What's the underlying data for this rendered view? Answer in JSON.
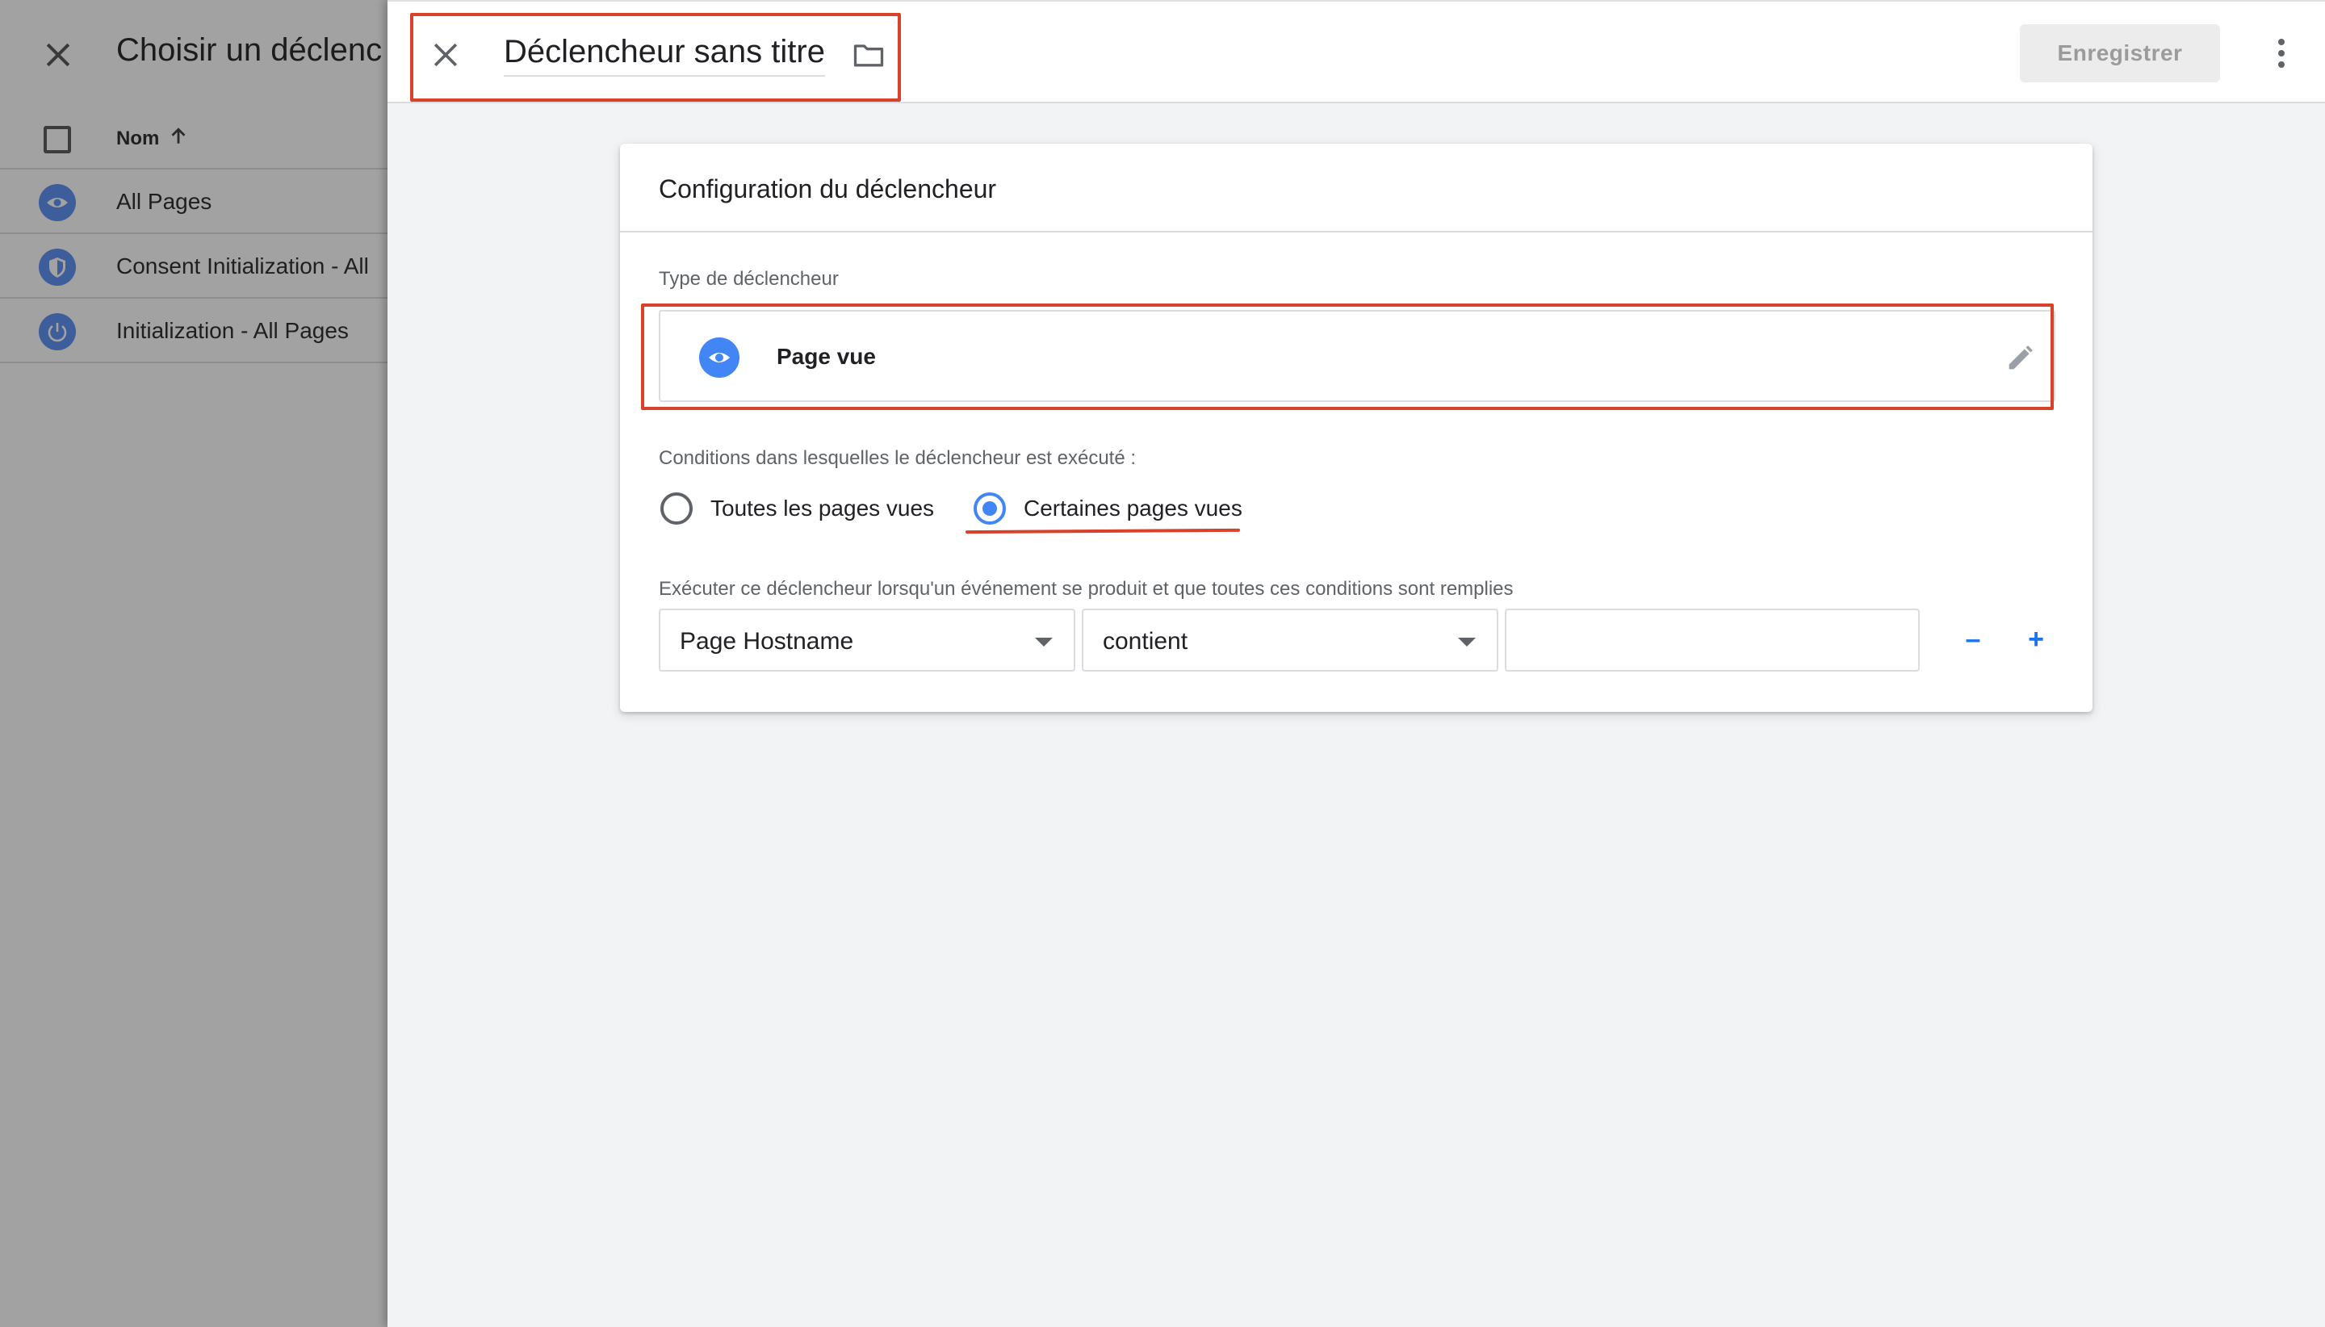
{
  "background_panel": {
    "title": "Choisir un déclenc",
    "column_header": "Nom",
    "rows": [
      {
        "label": "All Pages",
        "icon": "eye-icon"
      },
      {
        "label": "Consent Initialization - All",
        "icon": "shield-icon"
      },
      {
        "label": "Initialization - All Pages",
        "icon": "power-icon"
      }
    ]
  },
  "editor": {
    "trigger_name": "Déclencheur sans titre",
    "save_label": "Enregistrer",
    "card": {
      "title": "Configuration du déclencheur",
      "trigger_type_label": "Type de déclencheur",
      "trigger_type": {
        "name": "Page vue",
        "icon": "eye-icon"
      },
      "conditions_label": "Conditions dans lesquelles le déclencheur est exécuté :",
      "radio_options": [
        {
          "label": "Toutes les pages vues",
          "checked": false
        },
        {
          "label": "Certaines pages vues",
          "checked": true
        }
      ],
      "rule_label": "Exécuter ce déclencheur lorsqu'un événement se produit et que toutes ces conditions sont remplies",
      "rule": {
        "variable": "Page Hostname",
        "operator": "contient",
        "value": ""
      },
      "minus_label": "–",
      "plus_label": "+"
    }
  },
  "colors": {
    "accent_blue": "#4285f4",
    "annotation_red": "#d9412a"
  }
}
